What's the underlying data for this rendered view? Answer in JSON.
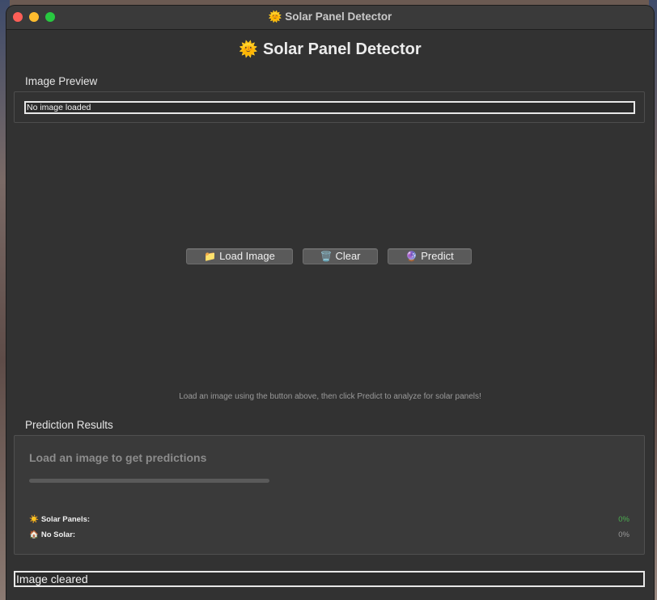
{
  "window": {
    "title": "Solar Panel Detector",
    "title_icon": "sun-face-icon"
  },
  "header": {
    "icon": "🌞",
    "title": "Solar Panel Detector"
  },
  "preview": {
    "label": "Image Preview",
    "status": "No image loaded"
  },
  "buttons": {
    "load": {
      "icon": "📁",
      "label": "Load Image"
    },
    "clear": {
      "icon": "🗑️",
      "label": "Clear"
    },
    "predict": {
      "icon": "🔮",
      "label": "Predict"
    }
  },
  "hint": "Load an image using the button above, then click Predict to analyze for solar panels!",
  "results": {
    "label": "Prediction Results",
    "status": "Load an image to get predictions",
    "progress": 0,
    "rows": [
      {
        "icon": "☀️",
        "label": "Solar Panels:",
        "value": "0%"
      },
      {
        "icon": "🏠",
        "label": "No Solar:",
        "value": "0%"
      }
    ]
  },
  "statusbar": "Image cleared",
  "colors": {
    "accent_green": "#4caf50",
    "window_bg": "#323232"
  }
}
